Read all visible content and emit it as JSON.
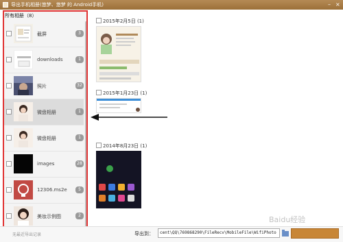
{
  "window": {
    "title": "导出手机相册(悠梦、悠梦 的 Android手机)"
  },
  "sidebar": {
    "header": "所有相册（8）",
    "albums": [
      {
        "name": "截屏",
        "count": "3"
      },
      {
        "name": "downloads",
        "count": "1"
      },
      {
        "name": "照片",
        "count": "32"
      },
      {
        "name": "微盘相册",
        "count": "1"
      },
      {
        "name": "微盘相册",
        "count": "1"
      },
      {
        "name": "images",
        "count": "28"
      },
      {
        "name": "12306.ms2e",
        "count": "5"
      },
      {
        "name": "美妆示例图",
        "count": "2"
      }
    ]
  },
  "groups": [
    {
      "date": "2015年2月5日 (1)"
    },
    {
      "date": "2015年1月23日 (1)"
    },
    {
      "date": "2014年8月23日 (1)"
    }
  ],
  "footer": {
    "no_record": "无最近导出记录",
    "export_label": "导出到：",
    "export_path": "cent\\QQ\\769868290\\FileRecv\\MobileFile\\WifiPhoto",
    "export_button": "",
    "browse_icon": "folder-icon"
  },
  "watermark": "Baidu经验",
  "colors": {
    "accent": "#c88636",
    "highlight_border": "#e03232",
    "titlebar": "#a67a44"
  }
}
